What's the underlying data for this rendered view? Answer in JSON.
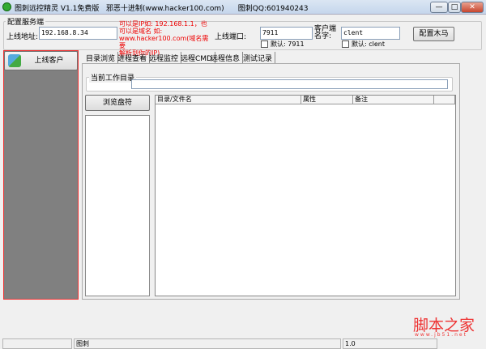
{
  "window": {
    "title": "图刺远控精灵 V1.1免费版   邪恶十进制(www.hacker100.com)      图刺QQ:601940243",
    "minimize": "—",
    "maximize": "□",
    "close": "✕"
  },
  "config": {
    "group_label": "配置服务端",
    "address_label": "上线地址:",
    "address_value": "192.168.8.34",
    "hint_lines": [
      "可以是IP如: 192.168.1.1，也",
      "可以是域名 如:",
      "www.hacker100.com(域名需要",
      "解析到你的IP)"
    ],
    "port_label": "上线端口:",
    "port_value": "7911",
    "port_default": "默认: 7911",
    "client_label_lines": [
      "客户端",
      "名字:"
    ],
    "client_value": "clent",
    "client_default": "默认: clent",
    "configure_button": "配置木马"
  },
  "sidebar": {
    "online_clients": "上线客户"
  },
  "tabs": [
    "目录浏览",
    "进程查看",
    "远程监控",
    "远程CMD",
    "远程信息",
    "测试记录"
  ],
  "browser": {
    "cwd_label": "当前工作目录",
    "cwd_value": "",
    "browse_drives": "浏览盘符",
    "columns": [
      "目录/文件名",
      "属性",
      "备注",
      ""
    ]
  },
  "status": {
    "panes": [
      "",
      "图刺",
      "1.0"
    ]
  },
  "watermark": {
    "title": "脚本之家",
    "url": "www.jb51.net"
  }
}
